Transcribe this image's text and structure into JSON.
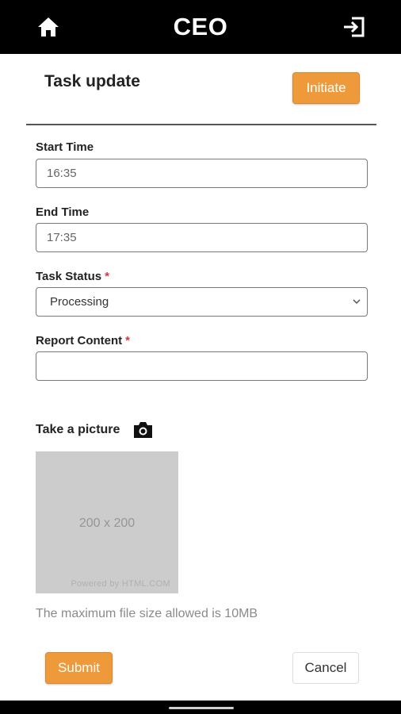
{
  "header": {
    "title": "CEO",
    "left_icon": "home-icon",
    "right_icon": "logout-icon"
  },
  "page": {
    "title": "Task update",
    "initiate_label": "Initiate"
  },
  "form": {
    "start_time": {
      "label": "Start Time",
      "value": "16:35"
    },
    "end_time": {
      "label": "End Time",
      "value": "17:35"
    },
    "task_status": {
      "label": "Task Status",
      "required_mark": "*",
      "selected": "Processing"
    },
    "report_content": {
      "label": "Report Content",
      "required_mark": "*",
      "value": ""
    }
  },
  "picture": {
    "label": "Take a picture",
    "icon": "camera-icon",
    "placeholder_text": "200 x 200",
    "powered_by": "Powered by HTML.COM",
    "file_note": "The maximum file size allowed is 10MB"
  },
  "actions": {
    "submit_label": "Submit",
    "cancel_label": "Cancel"
  },
  "colors": {
    "accent": "#ee9a3b",
    "required": "#d9363e",
    "header_bg": "#000000"
  }
}
